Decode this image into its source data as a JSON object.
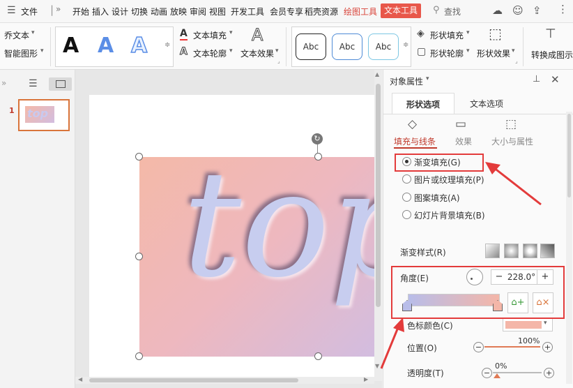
{
  "menubar": {
    "file_label": "文件",
    "items": [
      "开始",
      "插入",
      "设计",
      "切换",
      "动画",
      "放映",
      "审阅",
      "视图",
      "开发工具",
      "会员专享",
      "稻壳资源"
    ],
    "active_tabs": [
      "绘图工具",
      "文本工具"
    ],
    "search_label": "查找"
  },
  "ribbon": {
    "art_text_label": "乔文本",
    "smart_graphic_label": "智能图形",
    "big_a_letters": [
      "A",
      "A",
      "A"
    ],
    "text_fill_label": "文本填充",
    "text_outline_label": "文本轮廓",
    "text_effect_label": "文本效果",
    "shape_styles": [
      "Abc",
      "Abc",
      "Abc"
    ],
    "shape_fill_label": "形状填充",
    "shape_outline_label": "形状轮廓",
    "shape_effect_label": "形状效果",
    "convert_label": "转换成图示"
  },
  "thumbnail": {
    "number": "1",
    "text": "top"
  },
  "slide": {
    "text": "top"
  },
  "panel": {
    "title": "对象属性",
    "tabs": [
      "形状选项",
      "文本选项"
    ],
    "subtabs": [
      "填充与线条",
      "效果",
      "大小与属性"
    ],
    "fill_options": [
      {
        "label": "渐变填充(G)",
        "selected": true
      },
      {
        "label": "图片或纹理填充(P)",
        "selected": false
      },
      {
        "label": "图案填充(A)",
        "selected": false
      },
      {
        "label": "幻灯片背景填充(B)",
        "selected": false
      }
    ],
    "gradient_style_label": "渐变样式(R)",
    "angle_label": "角度(E)",
    "angle_value": "228.0°",
    "stop_color_label": "色标颜色(C)",
    "stop_color": "#f4b6a8",
    "position_label": "位置(O)",
    "position_value": "100%",
    "transparency_label": "透明度(T)",
    "transparency_value": "0%"
  },
  "colors": {
    "accent_red": "#e33b3b",
    "tab_highlight": "#e8574a",
    "gradient_start": "#b8bde9",
    "gradient_end": "#f4b6a8"
  }
}
